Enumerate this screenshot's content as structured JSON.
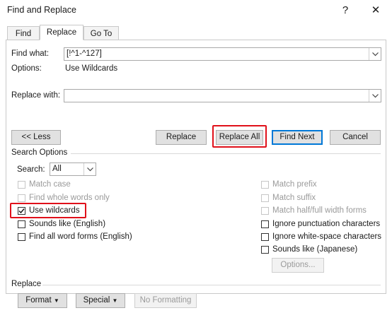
{
  "window": {
    "title": "Find and Replace",
    "help_label": "?",
    "close_label": "✕"
  },
  "tabs": [
    {
      "label": "Find"
    },
    {
      "label": "Replace"
    },
    {
      "label": "Go To"
    }
  ],
  "find": {
    "label": "Find what:",
    "value": "[!^1-^127]",
    "options_label": "Options:",
    "options_value": "Use Wildcards"
  },
  "replace": {
    "label": "Replace with:",
    "value": ""
  },
  "buttons": {
    "less": "<< Less",
    "replace": "Replace",
    "replace_all": "Replace All",
    "find_next": "Find Next",
    "cancel": "Cancel",
    "options": "Options...",
    "format": "Format",
    "special": "Special",
    "no_formatting": "No Formatting"
  },
  "search_options": {
    "heading": "Search Options",
    "search_label": "Search:",
    "search_value": "All",
    "left": [
      {
        "label": "Match case",
        "checked": false,
        "disabled": true
      },
      {
        "label": "Find whole words only",
        "checked": false,
        "disabled": true
      },
      {
        "label": "Use wildcards",
        "checked": true,
        "disabled": false
      },
      {
        "label": "Sounds like (English)",
        "checked": false,
        "disabled": false
      },
      {
        "label": "Find all word forms (English)",
        "checked": false,
        "disabled": false
      }
    ],
    "right": [
      {
        "label": "Match prefix",
        "checked": false,
        "disabled": true
      },
      {
        "label": "Match suffix",
        "checked": false,
        "disabled": true
      },
      {
        "label": "Match half/full width forms",
        "checked": false,
        "disabled": true
      },
      {
        "label": "Ignore punctuation characters",
        "checked": false,
        "disabled": false
      },
      {
        "label": "Ignore white-space characters",
        "checked": false,
        "disabled": false
      },
      {
        "label": "Sounds like (Japanese)",
        "checked": false,
        "disabled": false
      }
    ]
  },
  "replace_section": {
    "heading": "Replace"
  },
  "colors": {
    "highlight": "#e0101a",
    "primary_border": "#0078d7"
  }
}
